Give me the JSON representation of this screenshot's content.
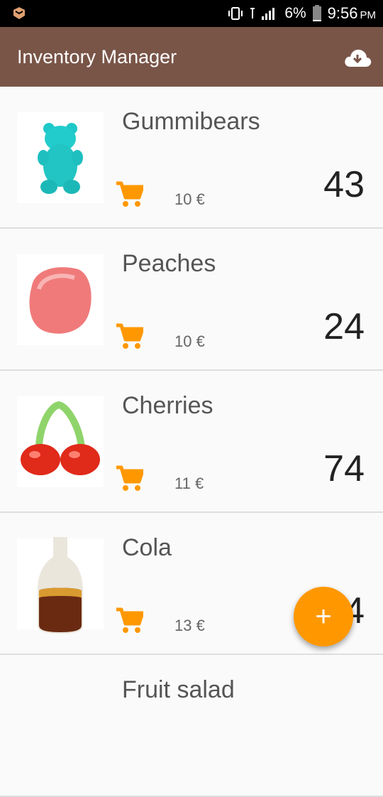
{
  "status_bar": {
    "battery_pct": "6%",
    "time": "9:56",
    "ampm": "PM",
    "icons": [
      "notification-icon",
      "vibrate-icon",
      "signal-icon",
      "battery-icon"
    ]
  },
  "app_bar": {
    "title": "Inventory Manager",
    "action_icon": "cloud-download-icon",
    "color": "#795548"
  },
  "items": [
    {
      "name": "Gummibears",
      "price": "10 €",
      "quantity": "43",
      "image": "gummy-bear-image"
    },
    {
      "name": "Peaches",
      "price": "10 €",
      "quantity": "24",
      "image": "peach-candy-image"
    },
    {
      "name": "Cherries",
      "price": "11 €",
      "quantity": "74",
      "image": "cherry-candy-image"
    },
    {
      "name": "Cola",
      "price": "13 €",
      "quantity": "4",
      "image": "cola-bottle-image"
    },
    {
      "name": "Fruit salad",
      "price": "",
      "quantity": "",
      "image": ""
    }
  ],
  "fab": {
    "label": "+",
    "icon": "add-icon",
    "color": "#ff9800"
  },
  "accent_color": "#ff9800"
}
